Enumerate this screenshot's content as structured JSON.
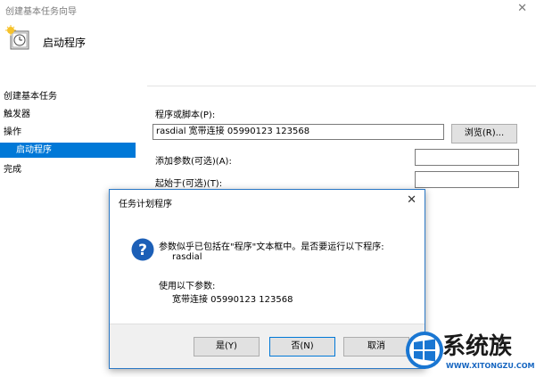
{
  "window": {
    "title": "创建基本任务向导",
    "close_glyph": "✕"
  },
  "header": {
    "icon": "clock-task-icon",
    "title": "启动程序"
  },
  "sidebar": {
    "items": [
      {
        "label": "创建基本任务"
      },
      {
        "label": "触发器"
      },
      {
        "label": "操作"
      },
      {
        "label": "启动程序",
        "selected": true
      },
      {
        "label": "完成"
      }
    ]
  },
  "form": {
    "program_label": "程序或脚本(P):",
    "program_value": "rasdial 宽带连接 05990123 123568",
    "browse_label": "浏览(R)...",
    "args_label": "添加参数(可选)(A):",
    "args_value": "",
    "startin_label": "起始于(可选)(T):",
    "startin_value": ""
  },
  "dialog": {
    "title": "任务计划程序",
    "close_glyph": "✕",
    "icon": "question-icon",
    "message_line1": "参数似乎已包括在\"程序\"文本框中。是否要运行以下程序:",
    "message_line2": "rasdial",
    "message_line3": "使用以下参数:",
    "message_line4": "宽带连接 05990123 123568",
    "yes_label": "是(Y)",
    "no_label": "否(N)",
    "cancel_label": "取消"
  },
  "watermark": {
    "brand": "系统族",
    "url": "WWW.XITONGZU.COM",
    "logo": "windows-logo-icon"
  },
  "colors": {
    "accent": "#0078d7",
    "dialog_border": "#2b78c5"
  }
}
